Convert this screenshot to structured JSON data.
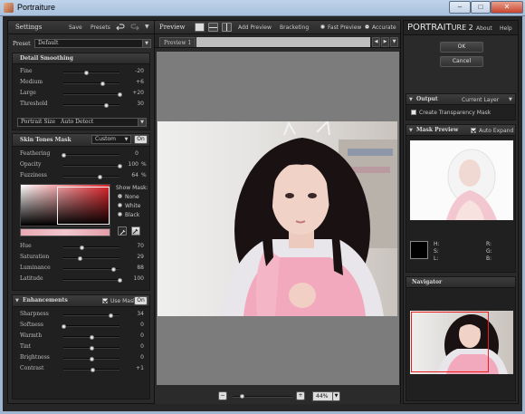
{
  "window": {
    "title": "Portraiture",
    "minimize": "–",
    "maximize": "□",
    "close": "✕"
  },
  "left": {
    "settings_label": "Settings",
    "save": "Save",
    "presets": "Presets",
    "preset_label": "Preset",
    "preset_value": "Default",
    "detail_smoothing": {
      "title": "Detail Smoothing",
      "sliders": [
        {
          "label": "Fine",
          "value": "-20",
          "pct": 0.4
        },
        {
          "label": "Medium",
          "value": "+6",
          "pct": 0.69
        },
        {
          "label": "Large",
          "value": "+20",
          "pct": 1.0
        },
        {
          "label": "Threshold",
          "value": "30",
          "pct": 0.75
        }
      ],
      "portrait_size_label": "Portrait Size",
      "portrait_size_value": "Auto Detect"
    },
    "skin_tones": {
      "title": "Skin Tones Mask",
      "mode": "Custom",
      "toggle": "On",
      "sliders": [
        {
          "label": "Feathering",
          "value": "0",
          "unit": "",
          "pct": 0.0
        },
        {
          "label": "Opacity",
          "value": "100",
          "unit": "%",
          "pct": 1.0
        },
        {
          "label": "Fuzziness",
          "value": "64",
          "unit": "%",
          "pct": 0.64
        }
      ],
      "show_mask_label": "Show Mask:",
      "show_mask_options": [
        "None",
        "White",
        "Black"
      ],
      "hsl_sliders": [
        {
          "label": "Hue",
          "value": "70",
          "pct": 0.33
        },
        {
          "label": "Saturation",
          "value": "29",
          "pct": 0.29
        },
        {
          "label": "Luminance",
          "value": "88",
          "pct": 0.88
        },
        {
          "label": "Latitude",
          "value": "100",
          "pct": 1.0
        }
      ]
    },
    "enhancements": {
      "title": "Enhancements",
      "use_mask_label": "Use Mask",
      "toggle": "On",
      "sliders": [
        {
          "label": "Sharpness",
          "value": "34",
          "pct": 0.84
        },
        {
          "label": "Softness",
          "value": "0",
          "pct": 0.0
        },
        {
          "label": "Warmth",
          "value": "0",
          "pct": 0.5
        },
        {
          "label": "Tint",
          "value": "0",
          "pct": 0.5
        },
        {
          "label": "Brightness",
          "value": "0",
          "pct": 0.5
        },
        {
          "label": "Contrast",
          "value": "+1",
          "pct": 0.52
        }
      ]
    }
  },
  "center": {
    "preview_label": "Preview",
    "add_preview": "Add Preview",
    "bracketing": "Bracketing",
    "fast_preview": "Fast Preview",
    "accurate": "Accurate",
    "tab": "Preview 1",
    "zoom_value": "44%",
    "zoom_minus": "−",
    "zoom_plus": "+"
  },
  "right": {
    "logo_main": "PORTRAIT",
    "logo_suffix": "URE 2",
    "about": "About",
    "help": "Help",
    "ok": "OK",
    "cancel": "Cancel",
    "output_label": "Output",
    "output_value": "Current Layer",
    "create_mask_label": "Create Transparency Mask",
    "mask_preview_label": "Mask Preview",
    "auto_expand_label": "Auto Expand",
    "color_readouts": [
      "H:",
      "S:",
      "L:",
      "R:",
      "G:",
      "B:"
    ],
    "navigator_label": "Navigator"
  }
}
